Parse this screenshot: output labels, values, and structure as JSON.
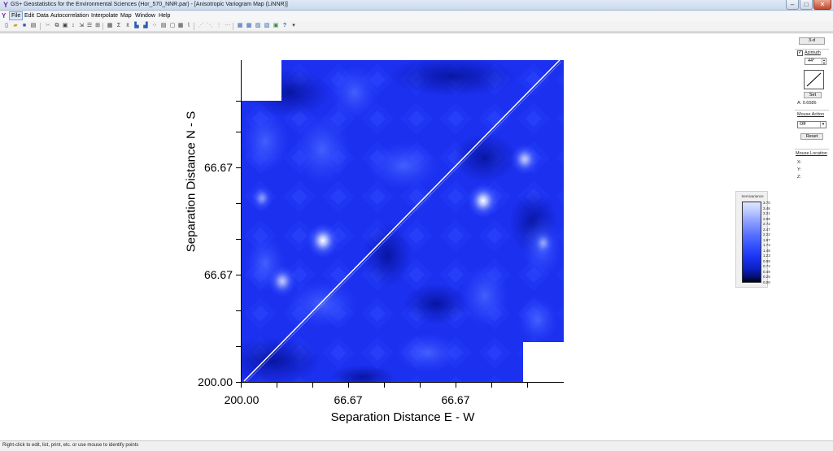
{
  "window": {
    "title": "GS+ Geostatistics for the Environmental Sciences (Hor_570_NNR.par) - [Anisotropic Variogram Map (LiNNR)]",
    "minimize": "–",
    "maximize": "□",
    "close": "✕"
  },
  "menu": {
    "items": [
      "File",
      "Edit",
      "Data",
      "Autocorrelation",
      "Interpolate",
      "Map",
      "Window",
      "Help"
    ]
  },
  "plot": {
    "x_axis_title": "Separation Distance E - W",
    "y_axis_title": "Separation Distance N - S",
    "x_tick_labels": [
      "200.00",
      "66.67",
      "66.67"
    ],
    "y_tick_labels": [
      "66.67",
      "66.67",
      "200.00"
    ]
  },
  "legend": {
    "title": "Semivariance",
    "labels": [
      "3.70",
      "3.46",
      "3.21",
      "2.96",
      "2.72",
      "2.47",
      "2.22",
      "1.97",
      "1.73",
      "1.48",
      "1.23",
      "0.99",
      "0.74",
      "0.49",
      "0.25",
      "0.00"
    ]
  },
  "panel": {
    "button_3d": "3-d",
    "azimuth_label": "Azimuth",
    "azimuth_value": "44°",
    "azimuth_checked": true,
    "set_button": "Set",
    "a_readout": "A: 0.6586",
    "mouse_action_label": "Mouse Action",
    "mouse_action_value": "Off",
    "reset_button": "Reset",
    "mouse_location_label": "Mouse Location",
    "x_label": "X:",
    "y_label": "Y:",
    "z_label": "Z:"
  },
  "status": {
    "text": "Right-click to edit, list, print, etc. or use mouse to identify points"
  },
  "colors": {
    "surface_base": "#1a2ff0",
    "surface_dark": "#0a18a8",
    "surface_light": "#3c5cff",
    "hotspot": "#ffffff"
  }
}
